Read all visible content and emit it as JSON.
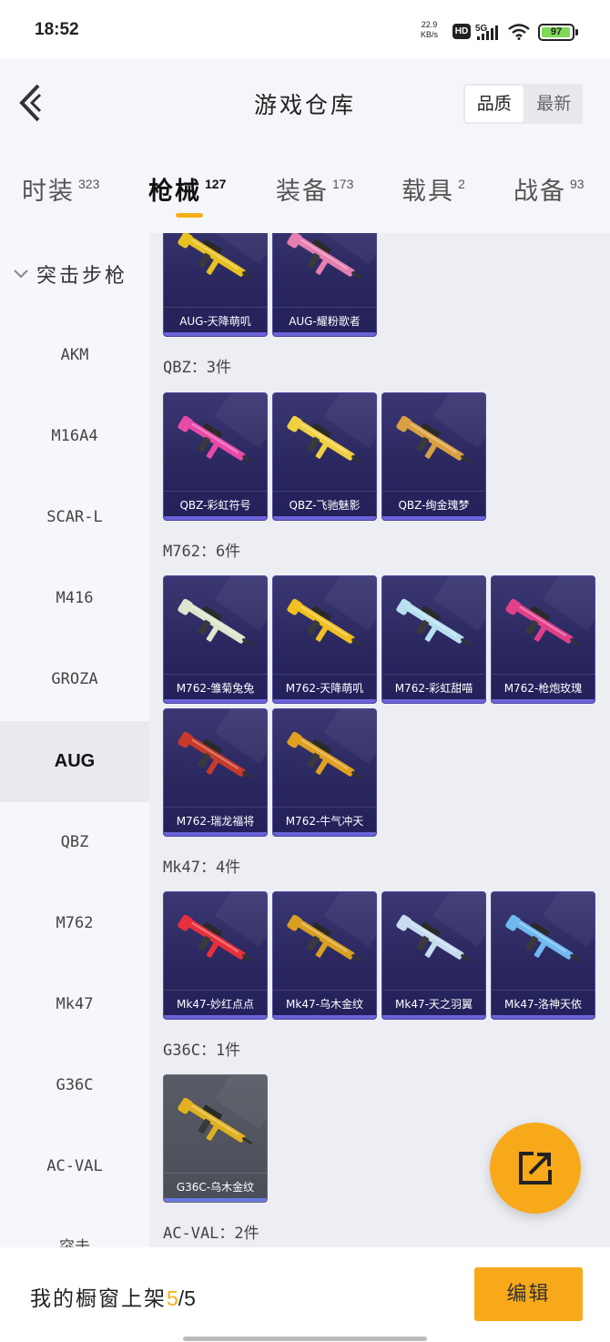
{
  "status": {
    "time": "18:52",
    "speed_value": "22.9",
    "speed_unit": "KB/s",
    "hd": "HD",
    "network": "5G",
    "battery": "97",
    "battery_level": 0.97
  },
  "header": {
    "title": "游戏仓库",
    "sort_options": [
      "品质",
      "最新"
    ],
    "sort_active": "品质"
  },
  "tabs": [
    {
      "label": "时装",
      "count": "323"
    },
    {
      "label": "枪械",
      "count": "127"
    },
    {
      "label": "装备",
      "count": "173"
    },
    {
      "label": "载具",
      "count": "2"
    },
    {
      "label": "战备",
      "count": "93"
    }
  ],
  "sidebar": {
    "group": "突击步枪",
    "items": [
      "AKM",
      "M16A4",
      "SCAR-L",
      "M416",
      "GROZA",
      "AUG",
      "QBZ",
      "M762",
      "Mk47",
      "G36C",
      "AC-VAL",
      "突击"
    ],
    "active": "AUG"
  },
  "sections": [
    {
      "label": "",
      "items": [
        {
          "name": "AUG-天降萌叽",
          "color": "#e8c020"
        },
        {
          "name": "AUG-耀粉歌者",
          "color": "#e57fb0"
        }
      ]
    },
    {
      "label": "QBZ：3件",
      "items": [
        {
          "name": "QBZ-彩虹符号",
          "color": "#e84aa8"
        },
        {
          "name": "QBZ-飞驰魅影",
          "color": "#f0d040"
        },
        {
          "name": "QBZ-绚金瑰梦",
          "color": "#d8a040"
        }
      ]
    },
    {
      "label": "M762：6件",
      "items": [
        {
          "name": "M762-雏菊兔兔",
          "color": "#dde6cc"
        },
        {
          "name": "M762-天降萌叽",
          "color": "#f0c020"
        },
        {
          "name": "M762-彩虹甜喵",
          "color": "#b8e0f0"
        },
        {
          "name": "M762-枪炮玫瑰",
          "color": "#e0408a"
        },
        {
          "name": "M762-瑞龙福将",
          "color": "#c83a2a"
        },
        {
          "name": "M762-牛气冲天",
          "color": "#e0a020"
        }
      ]
    },
    {
      "label": "Mk47：4件",
      "items": [
        {
          "name": "Mk47-妙红点点",
          "color": "#e8303a"
        },
        {
          "name": "Mk47-乌木金纹",
          "color": "#d8a020"
        },
        {
          "name": "Mk47-天之羽翼",
          "color": "#c8dcf0"
        },
        {
          "name": "Mk47-洛神天依",
          "color": "#70b8f0"
        }
      ]
    },
    {
      "label": "G36C：1件",
      "items": [
        {
          "name": "G36C-乌木金纹",
          "color": "#e0b020"
        }
      ]
    },
    {
      "label": "AC-VAL：2件",
      "items": []
    }
  ],
  "bottom": {
    "text": "我的橱窗上架",
    "count": "5",
    "total": "/5",
    "edit_label": "编辑"
  },
  "colors": {
    "accent": "#f8a91a",
    "indicator": "#f4b01a"
  }
}
